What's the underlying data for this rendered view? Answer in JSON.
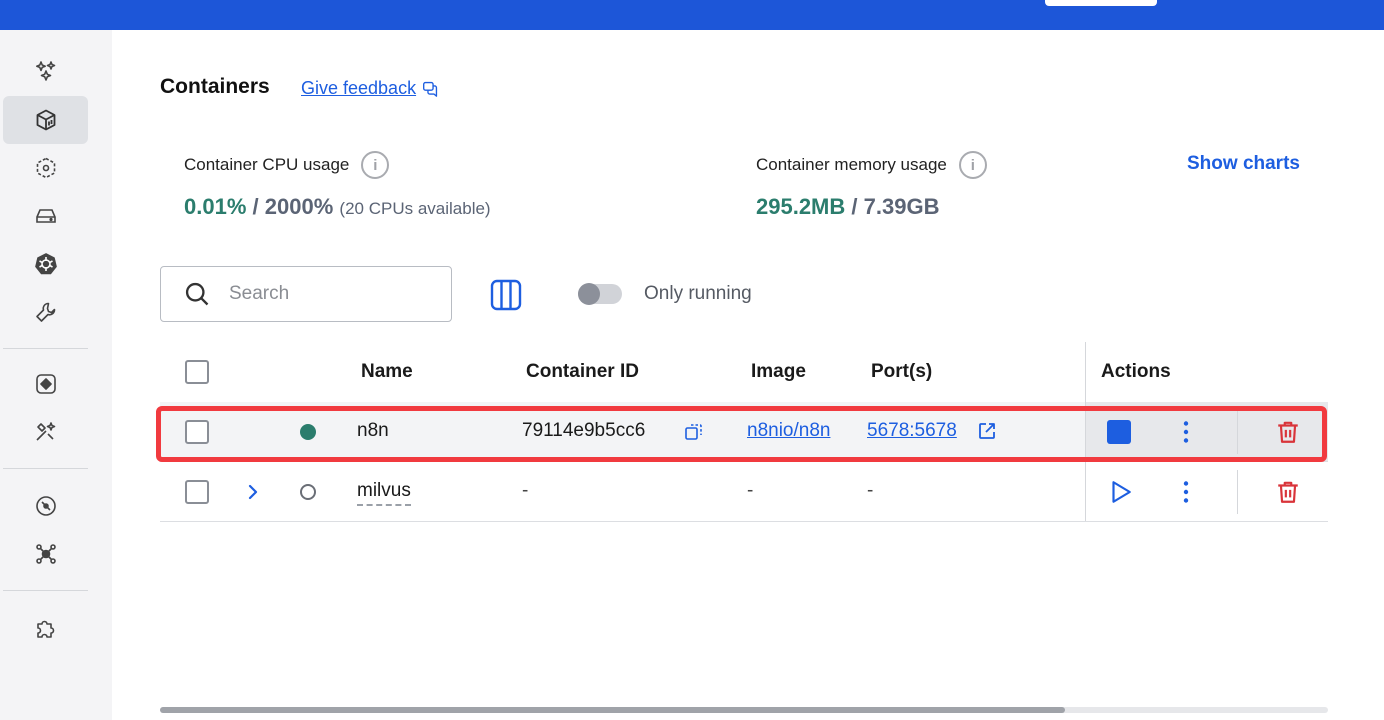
{
  "page": {
    "title": "Containers",
    "feedback_label": "Give feedback"
  },
  "stats": {
    "cpu_label": "Container CPU usage",
    "cpu_used": "0.01%",
    "cpu_separator": "/",
    "cpu_total": "2000%",
    "cpu_available": "(20 CPUs available)",
    "memory_label": "Container memory usage",
    "memory_used": "295.2MB",
    "memory_separator": "/",
    "memory_total": "7.39GB",
    "show_charts_label": "Show charts",
    "info_icon": "i"
  },
  "toolbar": {
    "search_placeholder": "Search",
    "only_running_label": "Only running",
    "only_running_enabled": false
  },
  "table": {
    "headers": {
      "name": "Name",
      "container_id": "Container ID",
      "image": "Image",
      "ports": "Port(s)",
      "actions": "Actions"
    },
    "rows": [
      {
        "name": "n8n",
        "status": "running",
        "container_id": "79114e9b5cc6",
        "image": "n8nio/n8n",
        "ports": "5678:5678"
      },
      {
        "name": "milvus",
        "status": "stopped",
        "container_id": "-",
        "image": "-",
        "ports": "-"
      }
    ]
  },
  "colors": {
    "accent": "#1d5ee0",
    "running": "#2b7d6d",
    "delete": "#d9343a",
    "highlight": "#f13a3f"
  },
  "sidebar": {
    "icons": [
      "sparkle-icon",
      "containers-icon",
      "images-icon",
      "volumes-icon",
      "kubernetes-icon",
      "dev-tools-icon",
      "extension-diamond-icon",
      "build-icon",
      "scout-icon",
      "models-icon",
      "extensions-icon"
    ]
  }
}
